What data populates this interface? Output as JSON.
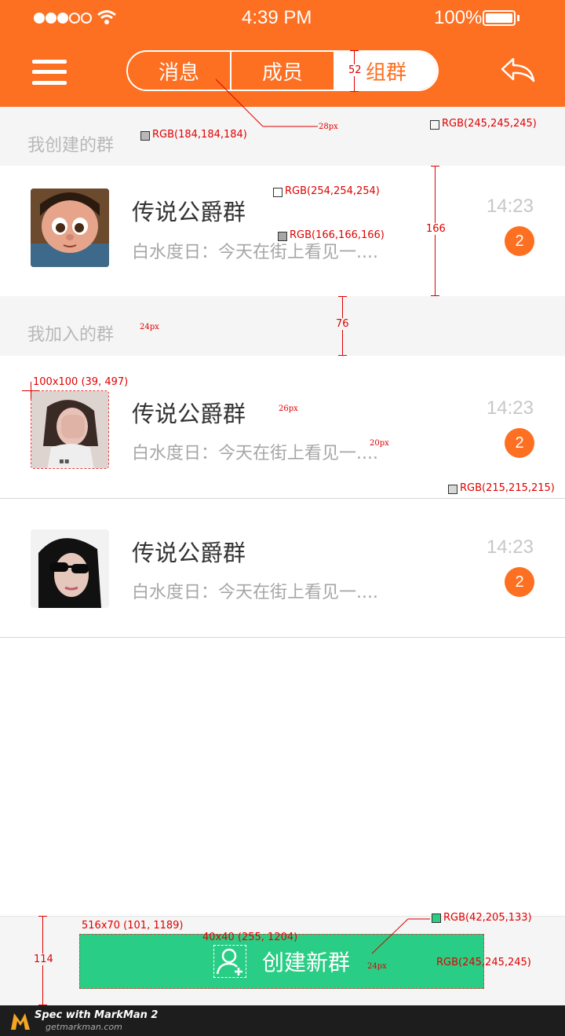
{
  "status_bar": {
    "time": "4:39 PM",
    "battery": "100%"
  },
  "header": {
    "tabs": [
      {
        "label": "消息",
        "active": false
      },
      {
        "label": "成员",
        "active": false
      },
      {
        "label": "组群",
        "active": true
      }
    ]
  },
  "sections": [
    {
      "title": "我创建的群",
      "groups": [
        {
          "name": "传说公爵群",
          "message": "白水度日：今天在街上看见一....",
          "time": "14:23",
          "unread": "2",
          "avatar": "cartoon-girl-avatar"
        }
      ]
    },
    {
      "title": "我加入的群",
      "groups": [
        {
          "name": "传说公爵群",
          "message": "白水度日：今天在街上看见一....",
          "time": "14:23",
          "unread": "2",
          "avatar": "woman-covering-face-avatar"
        },
        {
          "name": "传说公爵群",
          "message": "白水度日：今天在街上看见一....",
          "time": "14:23",
          "unread": "2",
          "avatar": "woman-sunglasses-avatar"
        }
      ]
    }
  ],
  "footer": {
    "create_label": "创建新群"
  },
  "annotations": {
    "seg_height": "52",
    "seg_font": "28px",
    "rgb_section_bg": "RGB(245,245,245)",
    "rgb_section_title": "RGB(184,184,184)",
    "rgb_name": "RGB(254,254,254)",
    "rgb_msg": "RGB(166,166,166)",
    "row_height": "166",
    "section_height": "76",
    "section_font": "24px",
    "avatar_spec": "100x100 (39, 497)",
    "name_font": "26px",
    "msg_font": "20px",
    "rgb_divider": "RGB(215,215,215)",
    "footer_height": "114",
    "btn_spec": "516x70 (101, 1189)",
    "icon_spec": "40x40 (255, 1204)",
    "rgb_btn": "RGB(42,205,133)",
    "btn_font": "24px",
    "rgb_footer": "RGB(245,245,245)"
  },
  "markman": {
    "title": "Spec with MarkMan 2",
    "url": "getmarkman.com"
  },
  "colors": {
    "accent": "#fd6f21",
    "section_bg": "#f5f5f5",
    "create_green": "#2acd85",
    "divider": "#d7d7d7"
  }
}
